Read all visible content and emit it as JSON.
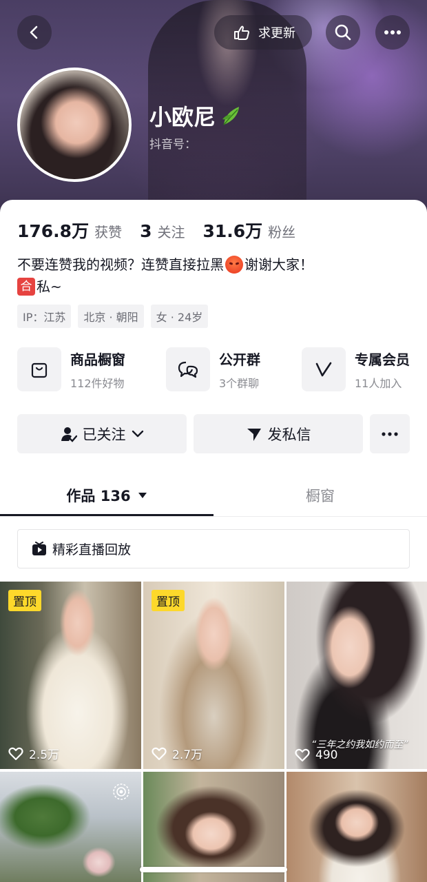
{
  "header": {
    "update_label": "求更新",
    "nickname": "小欧尼",
    "douyin_id_label": "抖音号："
  },
  "stats": [
    {
      "value": "176.8万",
      "label": "获赞"
    },
    {
      "value": "3",
      "label": "关注"
    },
    {
      "value": "31.6万",
      "label": "粉丝"
    }
  ],
  "bio": {
    "line1_before": "不要连赞我的视频？连赞直接拉黑",
    "line1_after": "谢谢大家！",
    "line2_badge": "合",
    "line2_text": "私~"
  },
  "tags": [
    "IP：江苏",
    "北京 · 朝阳",
    "女 · 24岁"
  ],
  "features": [
    {
      "title": "商品橱窗",
      "sub": "112件好物",
      "icon": "shopping-bag-icon"
    },
    {
      "title": "公开群",
      "sub": "3个群聊",
      "icon": "chat-bubbles-icon"
    },
    {
      "title": "专属会员",
      "sub": "11人加入",
      "icon": "member-v-icon"
    }
  ],
  "actions": {
    "followed_label": "已关注",
    "message_label": "发私信"
  },
  "tabs": {
    "works_label": "作品 136",
    "showcase_label": "橱窗"
  },
  "replay": {
    "label": "精彩直播回放"
  },
  "videos": [
    {
      "pinned": true,
      "pin_label": "置顶",
      "likes": "2.5万"
    },
    {
      "pinned": true,
      "pin_label": "置顶",
      "likes": "2.7万"
    },
    {
      "pinned": false,
      "likes": "490",
      "caption": "“三年之约我如约而至”"
    },
    {
      "pinned": false,
      "likes": ""
    },
    {
      "pinned": false,
      "likes": ""
    },
    {
      "pinned": false,
      "likes": ""
    }
  ],
  "colors": {
    "pin_badge": "#fdd82b",
    "accent_red": "#e64340",
    "text_primary": "#161823",
    "text_secondary": "#8a8b91"
  }
}
